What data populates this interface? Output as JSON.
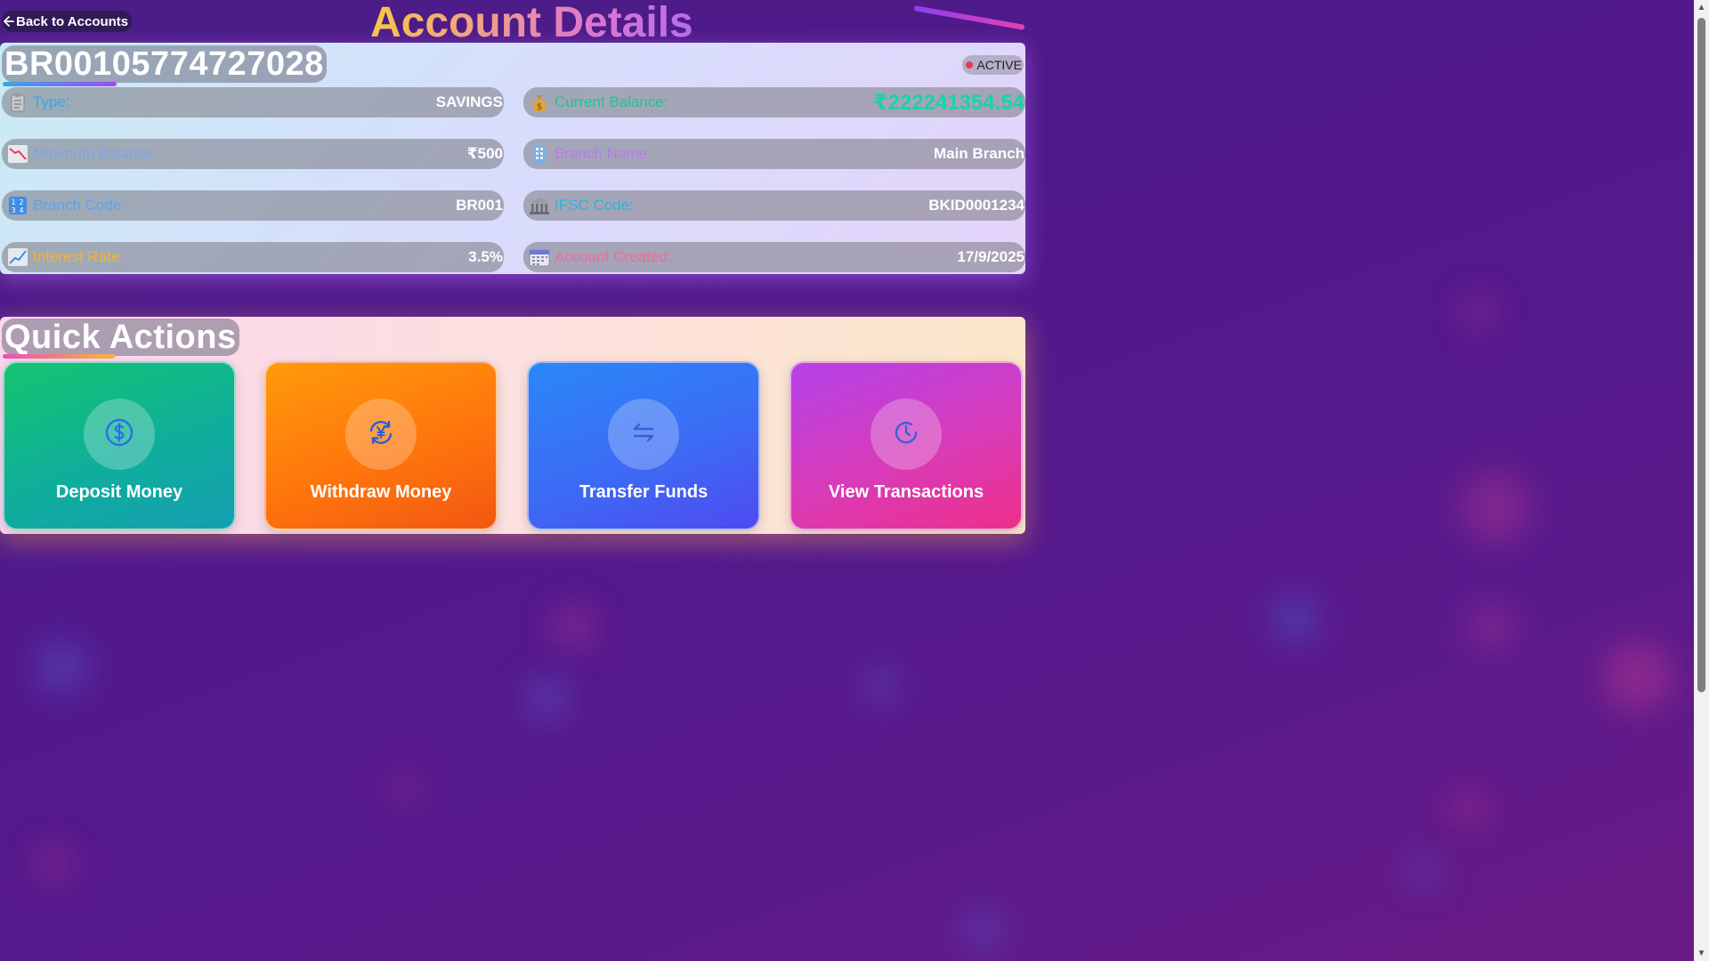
{
  "nav": {
    "back_label": "Back to Accounts"
  },
  "page": {
    "title": "Account Details"
  },
  "account": {
    "number": "BR00105774727028",
    "status": "ACTIVE",
    "fields": {
      "type": {
        "label": "Type:",
        "value": "SAVINGS",
        "icon": "clipboard-icon",
        "label_color": "#37a7e0"
      },
      "current_balance": {
        "label": "Current Balance:",
        "value": "₹222241354.54",
        "icon": "money-bag-icon",
        "label_color": "#19c98e",
        "value_color": "#18d3a6"
      },
      "minimum_balance": {
        "label": "Minimum Balance:",
        "value": "₹500",
        "icon": "chart-decreasing-icon",
        "label_color": "#7fa3e8"
      },
      "branch_name": {
        "label": "Branch Name:",
        "value": "Main Branch",
        "icon": "building-icon",
        "label_color": "#b57ce6"
      },
      "branch_code": {
        "label": "Branch Code:",
        "value": "BR001",
        "icon": "numbers-icon",
        "label_color": "#5aa4ee"
      },
      "ifsc_code": {
        "label": "IFSC Code:",
        "value": "BKID0001234",
        "icon": "bank-icon",
        "label_color": "#27b7d6"
      },
      "interest_rate": {
        "label": "Interest Rate:",
        "value": "3.5%",
        "icon": "chart-increasing-icon",
        "label_color": "#f7b32b"
      },
      "account_created": {
        "label": "Account Created:",
        "value": "17/9/2025",
        "icon": "calendar-icon",
        "label_color": "#ee6a9a"
      }
    }
  },
  "quick_actions": {
    "title": "Quick Actions",
    "actions": [
      {
        "label": "Deposit Money",
        "icon": "dollar-coin-icon"
      },
      {
        "label": "Withdraw Money",
        "icon": "yen-refresh-icon"
      },
      {
        "label": "Transfer Funds",
        "icon": "transfer-arrows-icon"
      },
      {
        "label": "View Transactions",
        "icon": "clock-icon"
      }
    ]
  }
}
